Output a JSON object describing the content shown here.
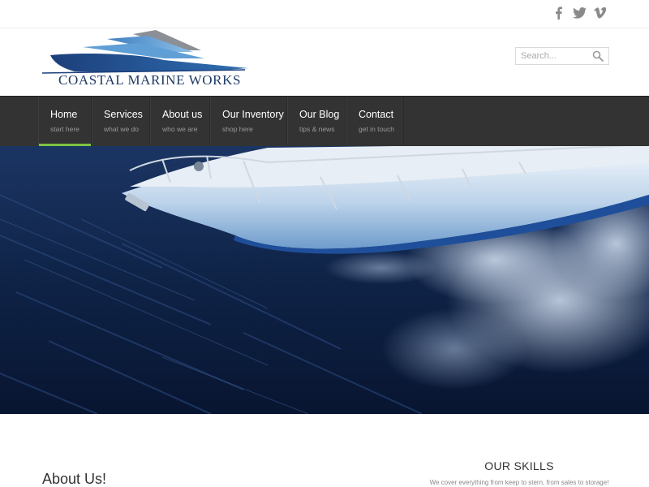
{
  "social": {
    "icons": [
      "facebook-icon",
      "twitter-icon",
      "vimeo-icon"
    ],
    "color": "#8a8a8a"
  },
  "header": {
    "logo_text": "COASTAL MARINE WORKS",
    "search": {
      "placeholder": "Search...",
      "value": ""
    }
  },
  "nav": {
    "accent": "#7dc242",
    "items": [
      {
        "label": "Home",
        "sub": "start here",
        "active": true
      },
      {
        "label": "Services",
        "sub": "what we do"
      },
      {
        "label": "About us",
        "sub": "who we are"
      },
      {
        "label": "Our Inventory",
        "sub": "shop here"
      },
      {
        "label": "Our Blog",
        "sub": "tips & news"
      },
      {
        "label": "Contact",
        "sub": "get in touch"
      }
    ]
  },
  "hero": {
    "image": "aerial view of white motor yacht bow cutting through dark blue water"
  },
  "about": {
    "title": "About Us!"
  },
  "skills": {
    "title": "OUR SKILLS",
    "subtitle": "We cover everything from keep to stern, from sales to storage!"
  }
}
